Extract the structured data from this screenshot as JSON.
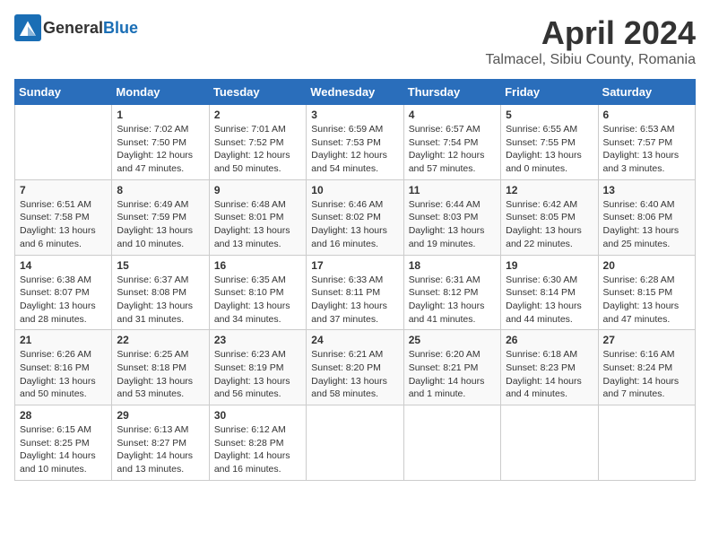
{
  "header": {
    "logo_general": "General",
    "logo_blue": "Blue",
    "month": "April 2024",
    "location": "Talmacel, Sibiu County, Romania"
  },
  "weekdays": [
    "Sunday",
    "Monday",
    "Tuesday",
    "Wednesday",
    "Thursday",
    "Friday",
    "Saturday"
  ],
  "weeks": [
    [
      {
        "day": "",
        "info": ""
      },
      {
        "day": "1",
        "info": "Sunrise: 7:02 AM\nSunset: 7:50 PM\nDaylight: 12 hours\nand 47 minutes."
      },
      {
        "day": "2",
        "info": "Sunrise: 7:01 AM\nSunset: 7:52 PM\nDaylight: 12 hours\nand 50 minutes."
      },
      {
        "day": "3",
        "info": "Sunrise: 6:59 AM\nSunset: 7:53 PM\nDaylight: 12 hours\nand 54 minutes."
      },
      {
        "day": "4",
        "info": "Sunrise: 6:57 AM\nSunset: 7:54 PM\nDaylight: 12 hours\nand 57 minutes."
      },
      {
        "day": "5",
        "info": "Sunrise: 6:55 AM\nSunset: 7:55 PM\nDaylight: 13 hours\nand 0 minutes."
      },
      {
        "day": "6",
        "info": "Sunrise: 6:53 AM\nSunset: 7:57 PM\nDaylight: 13 hours\nand 3 minutes."
      }
    ],
    [
      {
        "day": "7",
        "info": "Sunrise: 6:51 AM\nSunset: 7:58 PM\nDaylight: 13 hours\nand 6 minutes."
      },
      {
        "day": "8",
        "info": "Sunrise: 6:49 AM\nSunset: 7:59 PM\nDaylight: 13 hours\nand 10 minutes."
      },
      {
        "day": "9",
        "info": "Sunrise: 6:48 AM\nSunset: 8:01 PM\nDaylight: 13 hours\nand 13 minutes."
      },
      {
        "day": "10",
        "info": "Sunrise: 6:46 AM\nSunset: 8:02 PM\nDaylight: 13 hours\nand 16 minutes."
      },
      {
        "day": "11",
        "info": "Sunrise: 6:44 AM\nSunset: 8:03 PM\nDaylight: 13 hours\nand 19 minutes."
      },
      {
        "day": "12",
        "info": "Sunrise: 6:42 AM\nSunset: 8:05 PM\nDaylight: 13 hours\nand 22 minutes."
      },
      {
        "day": "13",
        "info": "Sunrise: 6:40 AM\nSunset: 8:06 PM\nDaylight: 13 hours\nand 25 minutes."
      }
    ],
    [
      {
        "day": "14",
        "info": "Sunrise: 6:38 AM\nSunset: 8:07 PM\nDaylight: 13 hours\nand 28 minutes."
      },
      {
        "day": "15",
        "info": "Sunrise: 6:37 AM\nSunset: 8:08 PM\nDaylight: 13 hours\nand 31 minutes."
      },
      {
        "day": "16",
        "info": "Sunrise: 6:35 AM\nSunset: 8:10 PM\nDaylight: 13 hours\nand 34 minutes."
      },
      {
        "day": "17",
        "info": "Sunrise: 6:33 AM\nSunset: 8:11 PM\nDaylight: 13 hours\nand 37 minutes."
      },
      {
        "day": "18",
        "info": "Sunrise: 6:31 AM\nSunset: 8:12 PM\nDaylight: 13 hours\nand 41 minutes."
      },
      {
        "day": "19",
        "info": "Sunrise: 6:30 AM\nSunset: 8:14 PM\nDaylight: 13 hours\nand 44 minutes."
      },
      {
        "day": "20",
        "info": "Sunrise: 6:28 AM\nSunset: 8:15 PM\nDaylight: 13 hours\nand 47 minutes."
      }
    ],
    [
      {
        "day": "21",
        "info": "Sunrise: 6:26 AM\nSunset: 8:16 PM\nDaylight: 13 hours\nand 50 minutes."
      },
      {
        "day": "22",
        "info": "Sunrise: 6:25 AM\nSunset: 8:18 PM\nDaylight: 13 hours\nand 53 minutes."
      },
      {
        "day": "23",
        "info": "Sunrise: 6:23 AM\nSunset: 8:19 PM\nDaylight: 13 hours\nand 56 minutes."
      },
      {
        "day": "24",
        "info": "Sunrise: 6:21 AM\nSunset: 8:20 PM\nDaylight: 13 hours\nand 58 minutes."
      },
      {
        "day": "25",
        "info": "Sunrise: 6:20 AM\nSunset: 8:21 PM\nDaylight: 14 hours\nand 1 minute."
      },
      {
        "day": "26",
        "info": "Sunrise: 6:18 AM\nSunset: 8:23 PM\nDaylight: 14 hours\nand 4 minutes."
      },
      {
        "day": "27",
        "info": "Sunrise: 6:16 AM\nSunset: 8:24 PM\nDaylight: 14 hours\nand 7 minutes."
      }
    ],
    [
      {
        "day": "28",
        "info": "Sunrise: 6:15 AM\nSunset: 8:25 PM\nDaylight: 14 hours\nand 10 minutes."
      },
      {
        "day": "29",
        "info": "Sunrise: 6:13 AM\nSunset: 8:27 PM\nDaylight: 14 hours\nand 13 minutes."
      },
      {
        "day": "30",
        "info": "Sunrise: 6:12 AM\nSunset: 8:28 PM\nDaylight: 14 hours\nand 16 minutes."
      },
      {
        "day": "",
        "info": ""
      },
      {
        "day": "",
        "info": ""
      },
      {
        "day": "",
        "info": ""
      },
      {
        "day": "",
        "info": ""
      }
    ]
  ]
}
